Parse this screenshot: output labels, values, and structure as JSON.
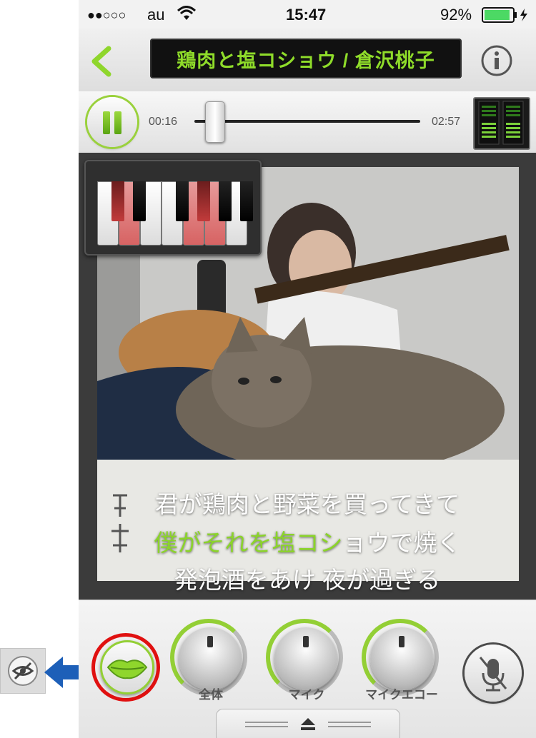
{
  "status_bar": {
    "signal": "●●○○○",
    "carrier": "au",
    "time": "15:47",
    "battery_percent": "92%",
    "battery_level": 0.92
  },
  "nav": {
    "back_icon": "chevron-left-icon",
    "title": "鶏肉と塩コショウ / 倉沢桃子",
    "info_icon": "info-icon"
  },
  "transport": {
    "elapsed": "00:16",
    "total": "02:57",
    "progress": 0.09
  },
  "piano": {
    "white_keys_on": [
      false,
      true,
      false,
      false,
      true,
      true,
      false
    ],
    "black_keys_on": [
      true,
      false,
      false,
      true,
      false,
      false
    ]
  },
  "lyrics": {
    "line1": "君が鶏肉と野菜を買ってきて",
    "line2_sung": "僕がそれを塩コシ",
    "line2_rest": "ョウで焼く",
    "line3": "発泡酒をあけ 夜が過ぎる"
  },
  "controls": {
    "knob_master_label": "全体",
    "knob_mic_label": "マイク",
    "knob_echo_label": "マイクエコー",
    "knob_master_level": 0.5,
    "knob_mic_level": 0.5,
    "knob_echo_level": 0.5,
    "mic_mute_icon": "mic-off-icon",
    "lips_icon": "lips-icon",
    "tray_icon": "eject-icon"
  },
  "colors": {
    "accent": "#8fdc2a",
    "highlight_ring": "#e01010",
    "arrow": "#1d5fb8"
  }
}
